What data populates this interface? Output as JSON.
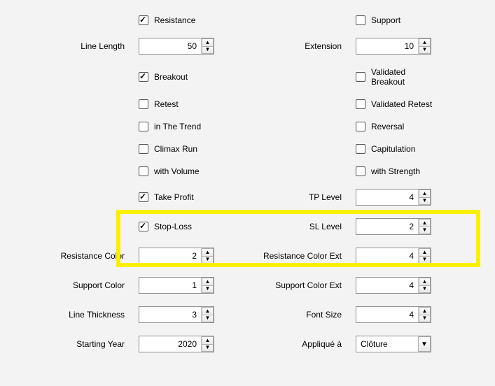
{
  "row1": {
    "resistance": {
      "label": "Resistance",
      "checked": true
    },
    "support": {
      "label": "Support",
      "checked": false
    }
  },
  "row2": {
    "lineLength": {
      "label": "Line Length",
      "value": "50"
    },
    "extension": {
      "label": "Extension",
      "value": "10"
    }
  },
  "row3": {
    "breakout": {
      "label": "Breakout",
      "checked": true
    },
    "validatedBreakout": {
      "label": "Validated Breakout",
      "checked": false
    }
  },
  "row4": {
    "retest": {
      "label": "Retest",
      "checked": false
    },
    "validatedRetest": {
      "label": "Validated Retest",
      "checked": false
    }
  },
  "row5": {
    "inTheTrend": {
      "label": "in The Trend",
      "checked": false
    },
    "reversal": {
      "label": "Reversal",
      "checked": false
    }
  },
  "row6": {
    "climaxRun": {
      "label": "Climax Run",
      "checked": false
    },
    "capitulation": {
      "label": "Capitulation",
      "checked": false
    }
  },
  "row7": {
    "withVolume": {
      "label": "with Volume",
      "checked": false
    },
    "withStrength": {
      "label": "with Strength",
      "checked": false
    }
  },
  "row8": {
    "takeProfit": {
      "label": "Take Profit",
      "checked": true
    },
    "tpLevel": {
      "label": "TP Level",
      "value": "4"
    }
  },
  "row9": {
    "stopLoss": {
      "label": "Stop-Loss",
      "checked": true
    },
    "slLevel": {
      "label": "SL Level",
      "value": "2"
    }
  },
  "row10": {
    "resistanceColor": {
      "label": "Resistance Color",
      "value": "2"
    },
    "resistanceColorExt": {
      "label": "Resistance Color Ext",
      "value": "4"
    }
  },
  "row11": {
    "supportColor": {
      "label": "Support Color",
      "value": "1"
    },
    "supportColorExt": {
      "label": "Support Color Ext",
      "value": "4"
    }
  },
  "row12": {
    "lineThickness": {
      "label": "Line Thickness",
      "value": "3"
    },
    "fontSize": {
      "label": "Font Size",
      "value": "4"
    }
  },
  "row13": {
    "startingYear": {
      "label": "Starting Year",
      "value": "2020"
    },
    "appliedTo": {
      "label": "Appliqué à",
      "value": "Clôture"
    }
  }
}
